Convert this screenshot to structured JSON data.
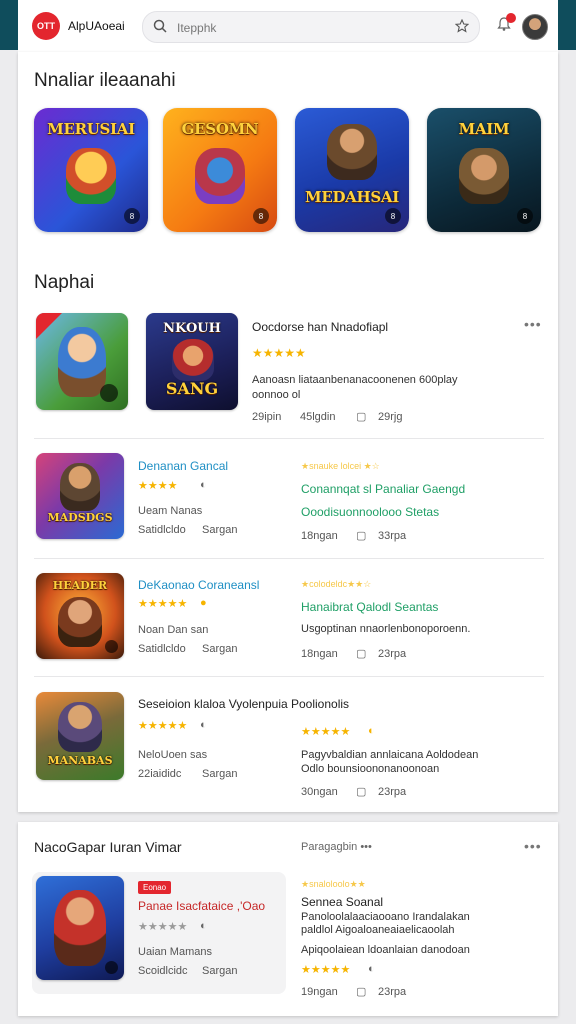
{
  "header": {
    "logo_text": "OTT",
    "app_name": "AlpUAoeai",
    "search_value": "Itepphk",
    "icons": [
      "search-icon",
      "star-icon",
      "bell-icon"
    ]
  },
  "featured": {
    "title": "Nnaliar ileaanahi",
    "tiles": [
      {
        "label": "MERUSIAI",
        "corner": "8"
      },
      {
        "label": "GESOMN",
        "corner": "8"
      },
      {
        "label": "MEDAHSAI",
        "corner": "8"
      },
      {
        "label": "MAIM",
        "corner": "8"
      }
    ]
  },
  "list_section": {
    "title": "Naphai",
    "items": [
      {
        "thumb1": "",
        "thumb2": "NKOUH",
        "thumb2_sub": "SANG",
        "title": "Oocdorse han Nnadofiapl",
        "stars": "★★★★★",
        "desc_line1": "Aanoasn liataanbenanacoonenen 600play",
        "desc_line2": "oonnoo ol",
        "meta1": "29ipin",
        "meta2": "45lgdin",
        "meta3": "29rjg",
        "menu": "•••"
      },
      {
        "thumb": "MADSDGS",
        "name": "Denanan Gancal",
        "stars": "★★★★",
        "sub1": "Ueam Nanas",
        "sub2": "Satidlcldo",
        "sub2b": "Sargan",
        "right_stars": "★snauke lolcei ★☆",
        "right1": "Conannqat sl Panaliar Gaengd",
        "right2": "Ooodisuonnoolooo Stetas",
        "meta1": "18ngan",
        "meta3": "33rpa"
      },
      {
        "thumb": "HEADER",
        "name": "DeKaonao Coraneansl",
        "stars": "★★★★★",
        "sub1": "Noan Dan san",
        "sub2": "Satidlcldo",
        "sub2b": "Sargan",
        "right_stars": "★colodeldc★★☆",
        "right1": "Hanaibrat Qalodl Seantas",
        "right2": "Usgoptinan  nnaorlenbonoporoenn.",
        "meta1": "18ngan",
        "meta3": "23rpa"
      },
      {
        "thumb": "MANABAS",
        "name": "Seseioion klaloa Vyolenpuia Poolionolis",
        "stars": "★★★★★",
        "sub1": "NeloUoen sas",
        "sub2": "22iaididc",
        "sub2b": "Sargan",
        "right_stars": "★★★★★",
        "right1": "Pagyvbaldian annlaicana Aoldodean",
        "right2": "Odlo bounsioononanoonoan",
        "meta1": "30ngan",
        "meta3": "23rpa"
      }
    ]
  },
  "bottom_section": {
    "title": "NacoGapar Iuran Vimar",
    "link": "Paragagbin •••",
    "menu": "•••",
    "item": {
      "thumb": "",
      "tag": "Eonao",
      "name": "Panae Isacfataice ,'Oao",
      "stars": "★★★★★",
      "sub1": "Uaian Mamans",
      "sub2": "Scoidlcidc",
      "sub2b": "Sargan",
      "right_stars": "★snaloloolo★★",
      "right_title": "Sennea Soanal",
      "right_desc1": "Panoloolalaaciaooano  Irandalakan",
      "right_desc2": "paldlol Aigoaloaneaiaelicaoolah",
      "right_desc3": "Apiqoolaiean ldoanlaian danodoan",
      "right_stars2": "★★★★★",
      "meta1": "19ngan",
      "meta3": "23rpa"
    }
  },
  "colors": {
    "topbar": "#0f4d5c",
    "accent_red": "#e3262e",
    "star": "#f6b400",
    "link_blue": "#1f8fc4",
    "link_green": "#1f9f66"
  }
}
